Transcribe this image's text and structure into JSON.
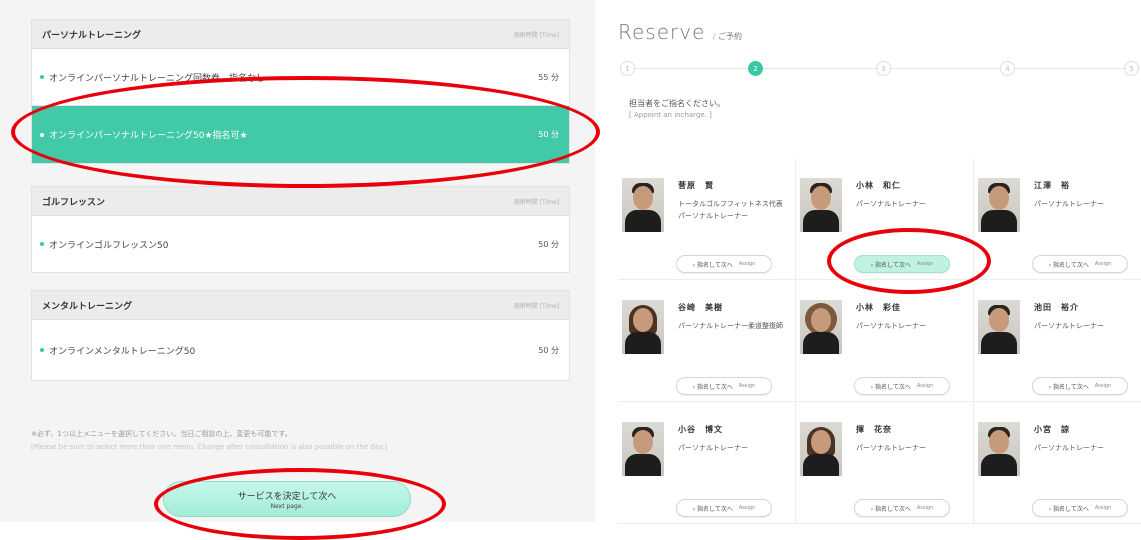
{
  "left": {
    "sections": [
      {
        "title": "パーソナルトレーニング",
        "time_label": "施術時間 [Time]",
        "items": [
          {
            "label": "オンラインパーソナルトレーニング回数券…指名なし",
            "duration": "55 分",
            "selected": false
          },
          {
            "label": "オンラインパーソナルトレーニング50★指名可★",
            "duration": "50 分",
            "selected": true
          }
        ]
      },
      {
        "title": "ゴルフレッスン",
        "time_label": "施術時間 [Time]",
        "items": [
          {
            "label": "オンラインゴルフレッスン50",
            "duration": "50 分",
            "selected": false
          }
        ]
      },
      {
        "title": "メンタルトレーニング",
        "time_label": "施術時間 [Time]",
        "items": [
          {
            "label": "オンラインメンタルトレーニング50",
            "duration": "50 分",
            "selected": false
          }
        ]
      }
    ],
    "note_jp": "※必ず、1つ以上メニューを選択してください。当日ご相談の上、変更も可能です。",
    "note_en": "[Please be sure to select more than one menu. Change after consultation is also possible on the day.]",
    "next_button_jp": "サービスを決定して次へ",
    "next_button_en": "Next page."
  },
  "right": {
    "title": "Reserve",
    "title_sub": "/ ご予約",
    "steps": [
      "1",
      "2",
      "3",
      "4",
      "5"
    ],
    "active_step": "2",
    "appoint_jp": "担当者をご指名ください。",
    "appoint_en": "[ Appoint an incharge. ]",
    "assign_label_jp": "› 指名して次へ",
    "assign_label_en": "Assign",
    "trainers": [
      {
        "name": "菅原　賢",
        "role": "トータルゴルフフィットネス代表パーソナルトレーナー",
        "photo": "male",
        "highlight": false
      },
      {
        "name": "小林　和仁",
        "role": "パーソナルトレーナー",
        "photo": "male",
        "highlight": true
      },
      {
        "name": "江澤　裕",
        "role": "パーソナルトレーナー",
        "photo": "male",
        "highlight": false
      },
      {
        "name": "谷崎　美樹",
        "role": "パーソナルトレーナー柔道整復師",
        "photo": "female",
        "highlight": false
      },
      {
        "name": "小林　彩佳",
        "role": "パーソナルトレーナー",
        "photo": "curly",
        "highlight": false
      },
      {
        "name": "池田　裕介",
        "role": "パーソナルトレーナー",
        "photo": "male",
        "highlight": false
      },
      {
        "name": "小谷　博文",
        "role": "パーソナルトレーナー",
        "photo": "male",
        "highlight": false
      },
      {
        "name": "揮　花奈",
        "role": "パーソナルトレーナー",
        "photo": "female",
        "highlight": false
      },
      {
        "name": "小宮　諒",
        "role": "パーソナルトレーナー",
        "photo": "male",
        "highlight": false
      }
    ]
  },
  "colors": {
    "accent": "#42c9a8",
    "annotation": "#e8000b"
  }
}
